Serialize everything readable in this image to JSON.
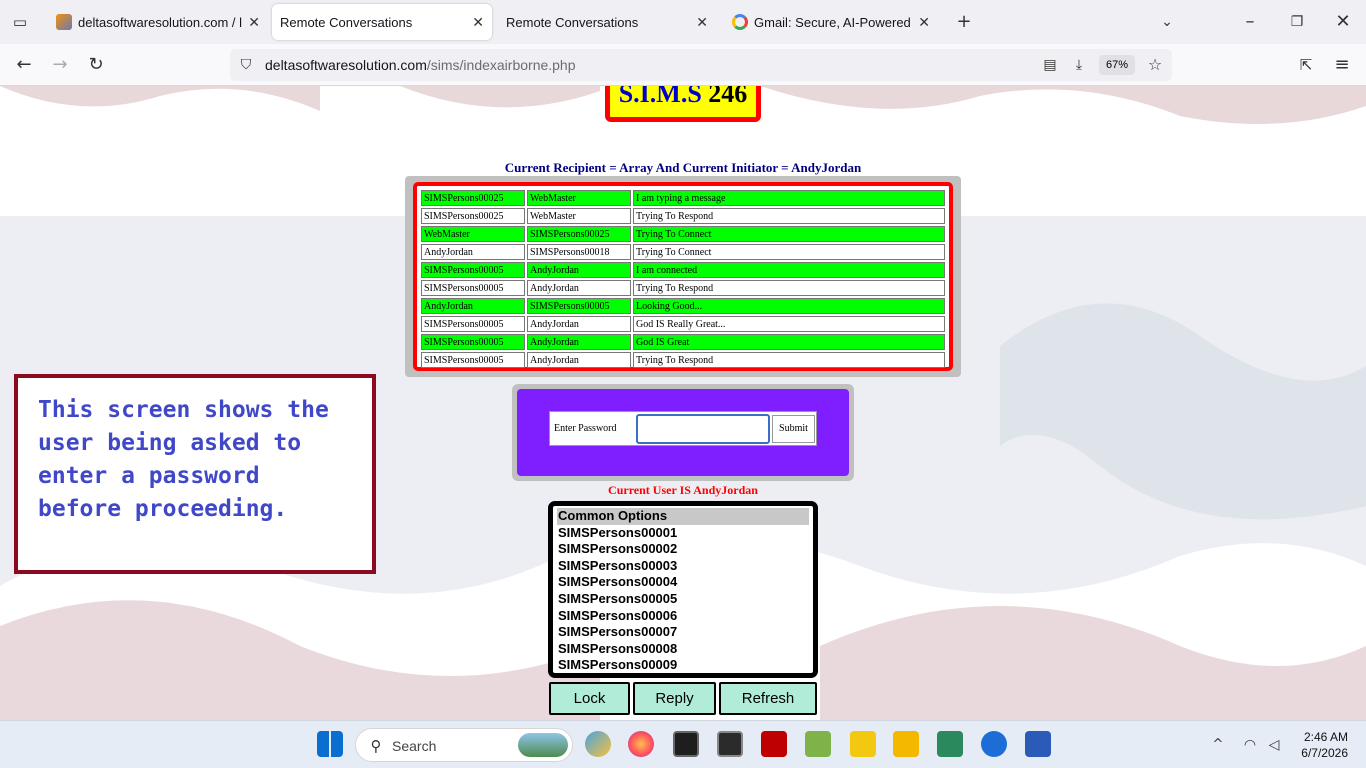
{
  "browser": {
    "tabs": [
      {
        "label": "deltasoftwaresolution.com / loc",
        "active": false
      },
      {
        "label": "Remote Conversations",
        "active": true
      },
      {
        "label": "Remote Conversations",
        "active": false
      },
      {
        "label": "Gmail: Secure, AI-Powered Emai",
        "active": false
      }
    ],
    "url_domain": "deltasoftwaresolution.com",
    "url_path": "/sims/indexairborne.php",
    "zoom": "67%"
  },
  "page": {
    "logo_text": "S.I.M.S",
    "logo_num": "246",
    "recipient_line": "Current Recipient = Array And Current Initiator = AndyJordan",
    "conversations": [
      [
        "SIMSPersons00025",
        "WebMaster",
        "I am typing a message"
      ],
      [
        "SIMSPersons00025",
        "WebMaster",
        "Trying To Respond"
      ],
      [
        "WebMaster",
        "SIMSPersons00025",
        "Trying To Connect"
      ],
      [
        "AndyJordan",
        "SIMSPersons00018",
        "Trying To Connect"
      ],
      [
        "SIMSPersons00005",
        "AndyJordan",
        "I am connected"
      ],
      [
        "SIMSPersons00005",
        "AndyJordan",
        "Trying To Respond"
      ],
      [
        "AndyJordan",
        "SIMSPersons00005",
        "Looking Good..."
      ],
      [
        "SIMSPersons00005",
        "AndyJordan",
        "God IS Really Great..."
      ],
      [
        "SIMSPersons00005",
        "AndyJordan",
        "God IS Great"
      ],
      [
        "SIMSPersons00005",
        "AndyJordan",
        "Trying To Respond"
      ]
    ],
    "password_label": "Enter Password",
    "password_value": "",
    "submit_label": "Submit",
    "current_user": "Current User IS AndyJordan",
    "options": [
      "Common Options",
      "SIMSPersons00001",
      "SIMSPersons00002",
      "SIMSPersons00003",
      "SIMSPersons00004",
      "SIMSPersons00005",
      "SIMSPersons00006",
      "SIMSPersons00007",
      "SIMSPersons00008",
      "SIMSPersons00009"
    ],
    "buttons": {
      "lock": "Lock",
      "reply": "Reply",
      "refresh": "Refresh"
    },
    "annotation": "This screen shows the user being asked to enter a password before proceeding.",
    "colors": {
      "row_green": "#00ff00",
      "panel_purple": "#7f1fff",
      "table_border": "#ff0000",
      "button_bg": "#b0ecd8"
    }
  },
  "taskbar": {
    "search_label": "Search",
    "time": "2:46 AM",
    "date": "6/7/2026",
    "icons": [
      "windows-start-icon",
      "search-icon",
      "app-icon",
      "firefox-icon",
      "terminal-icon",
      "cmd-icon",
      "filezilla-icon",
      "notepad-icon",
      "pdf-icon",
      "file-explorer-icon",
      "reader-icon",
      "help-icon",
      "word-icon"
    ]
  }
}
